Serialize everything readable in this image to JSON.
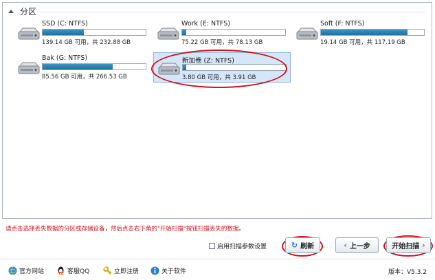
{
  "partition_panel": {
    "group_title": "分区",
    "drives": [
      {
        "name": "SSD (C: NTFS)",
        "size_text": "139.14 GB 可用，共 232.88 GB",
        "fill_fraction": 0.4,
        "selected": false
      },
      {
        "name": "Work (E: NTFS)",
        "size_text": "75.22 GB 可用，共 78.13 GB",
        "fill_fraction": 0.04,
        "selected": false
      },
      {
        "name": "Soft (F: NTFS)",
        "size_text": "19.14 GB 可用，共 117.19 GB",
        "fill_fraction": 0.84,
        "selected": false
      },
      {
        "name": "Bak (G: NTFS)",
        "size_text": "85.56 GB 可用，共 266.53 GB",
        "fill_fraction": 0.68,
        "selected": false
      },
      {
        "name": "新加卷 (Z: NTFS)",
        "size_text": "3.80 GB 可用，共 3.91 GB",
        "fill_fraction": 0.03,
        "selected": true
      }
    ]
  },
  "hint_text": "请点击选择丢失数据的分区或存储设备，然后点击右下角的\"开始扫描\"按钮扫描丢失的数据。",
  "controls": {
    "param_checkbox_label": "启用扫描参数设置",
    "param_checked": false,
    "refresh_label": "刷新",
    "back_label": "上一步",
    "start_label": "开始扫描"
  },
  "footer": {
    "links": [
      "官方网站",
      "客服QQ",
      "立即注册",
      "关于软件"
    ],
    "version_label": "版本：",
    "version_value": "V5.3.2"
  },
  "colors": {
    "accent_blue": "#2b7fd0",
    "bar_fill": "#1f6f9e",
    "selected_bg": "#d4e6f8",
    "annotation_red": "#d0101a"
  }
}
